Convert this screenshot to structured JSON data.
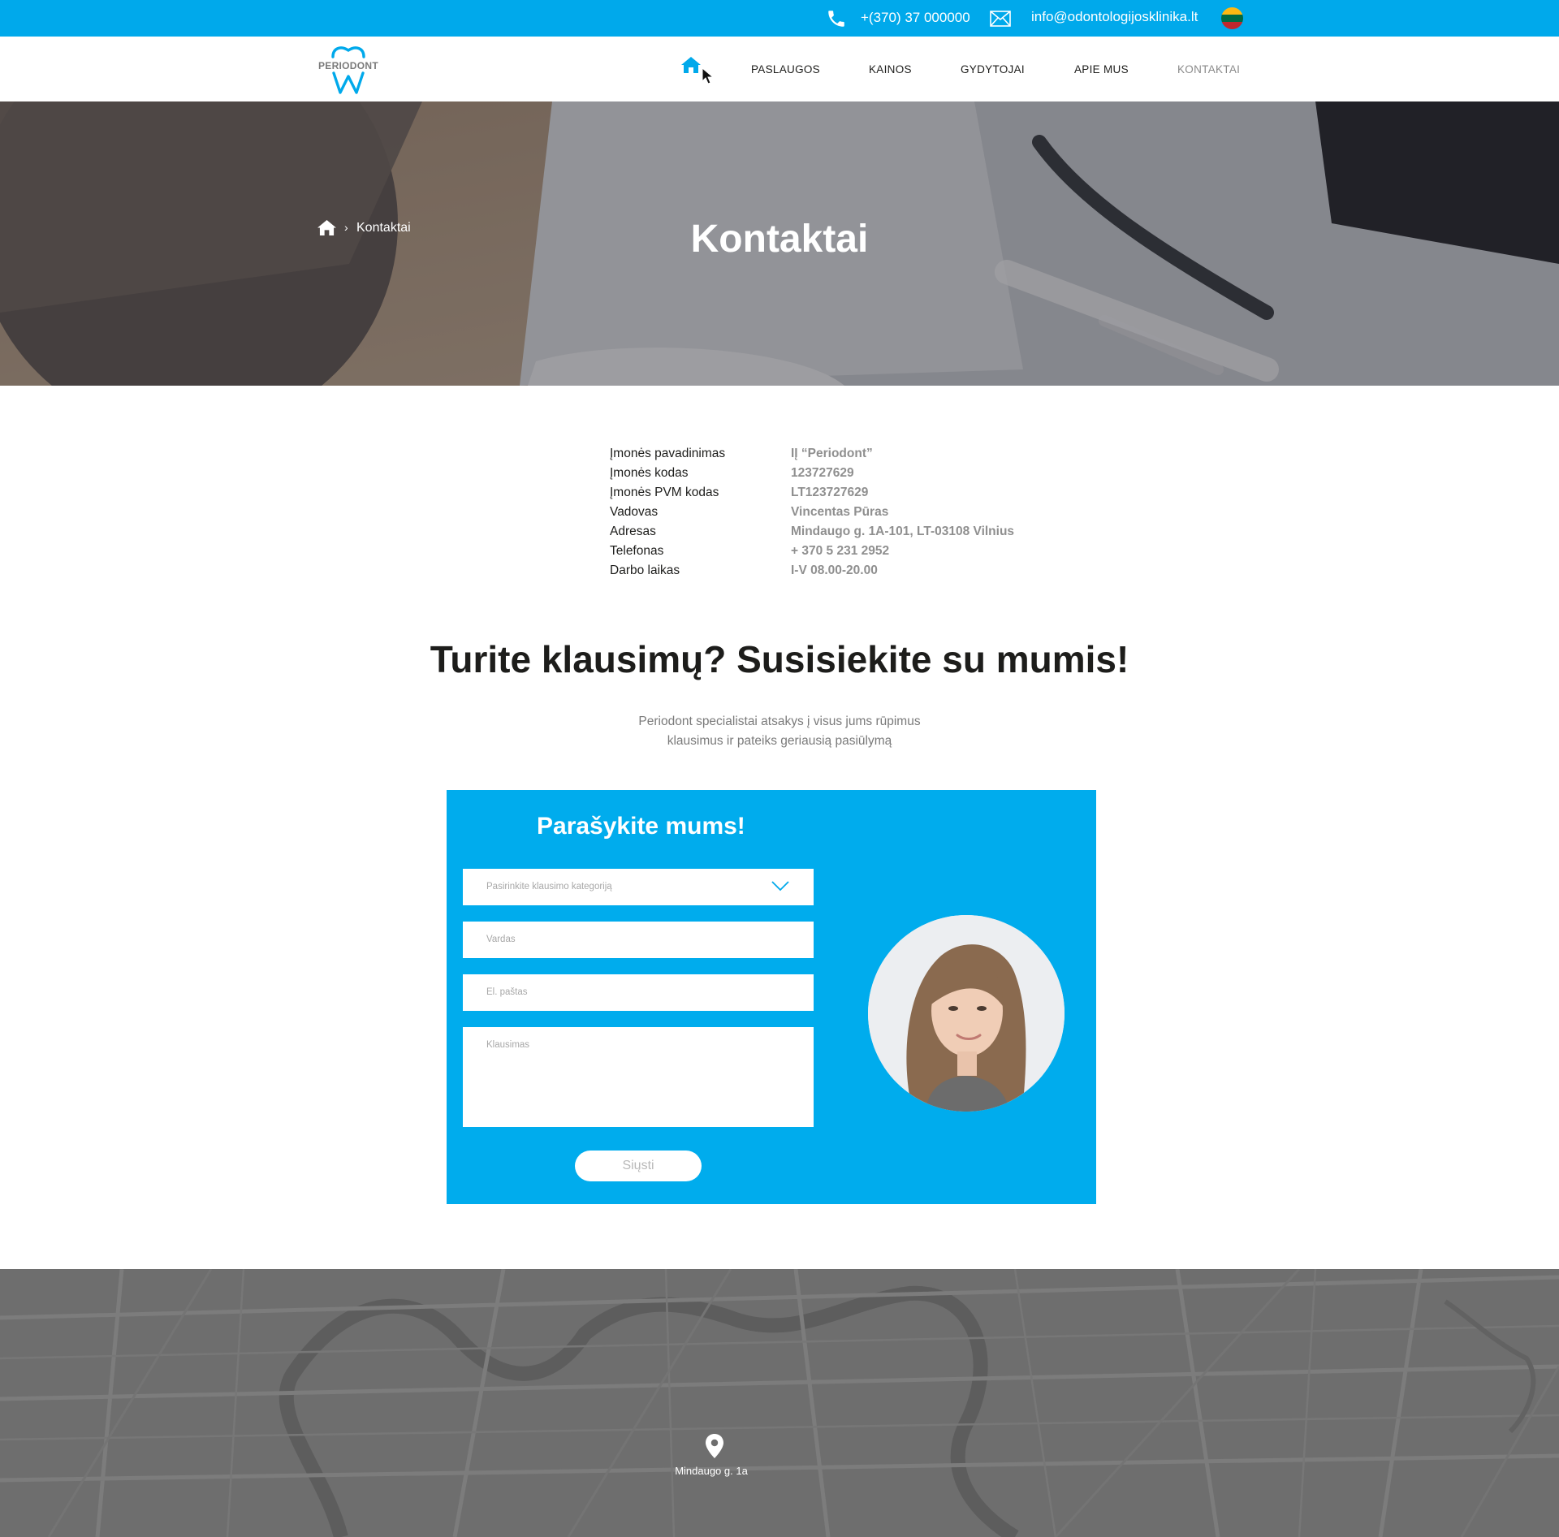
{
  "topbar": {
    "phone": "+(370) 37 000000",
    "email": "info@odontologijosklinika.lt",
    "phone_icon": "phone-icon",
    "mail_icon": "envelope-icon",
    "language_flag": "lithuania-flag-icon"
  },
  "header": {
    "logo_text": "PERIODONT",
    "nav": {
      "home_icon": "home-icon",
      "items": [
        "PASLAUGOS",
        "KAINOS",
        "GYDYTOJAI",
        "APIE MUS",
        "KONTAKTAI"
      ],
      "active": "KONTAKTAI"
    }
  },
  "hero": {
    "breadcrumb_current": "Kontaktai",
    "title": "Kontaktai"
  },
  "company_info": {
    "rows": [
      {
        "label": "Įmonės pavadinimas",
        "value": "IĮ “Periodont”"
      },
      {
        "label": "Įmonės kodas",
        "value": "123727629"
      },
      {
        "label": "Įmonės PVM kodas",
        "value": "LT123727629"
      },
      {
        "label": "Vadovas",
        "value": "Vincentas Pūras"
      },
      {
        "label": "Adresas",
        "value": "Mindaugo g. 1A-101, LT-03108 Vilnius"
      },
      {
        "label": "Telefonas",
        "value": "+ 370 5 231 2952"
      },
      {
        "label": "Darbo laikas",
        "value": "I-V 08.00-20.00"
      }
    ]
  },
  "cta": {
    "title": "Turite klausimų? Susisiekite su mumis!",
    "subtitle_line1": "Periodont specialistai atsakys į visus jums rūpimus",
    "subtitle_line2": "klausimus ir pateiks geriausią pasiūlymą"
  },
  "form": {
    "title": "Parašykite mums!",
    "category_placeholder": "Pasirinkite klausimo kategoriją",
    "name_placeholder": "Vardas",
    "email_placeholder": "El. paštas",
    "question_placeholder": "Klausimas",
    "submit_label": "Siųsti"
  },
  "map": {
    "address": "Mindaugo g. 1a",
    "pin_icon": "map-pin-icon"
  },
  "colors": {
    "brand_blue": "#00a9eb",
    "text_dark": "#1d1d1b",
    "text_muted": "#8f8f8f",
    "map_gray": "#6e6e6e"
  }
}
